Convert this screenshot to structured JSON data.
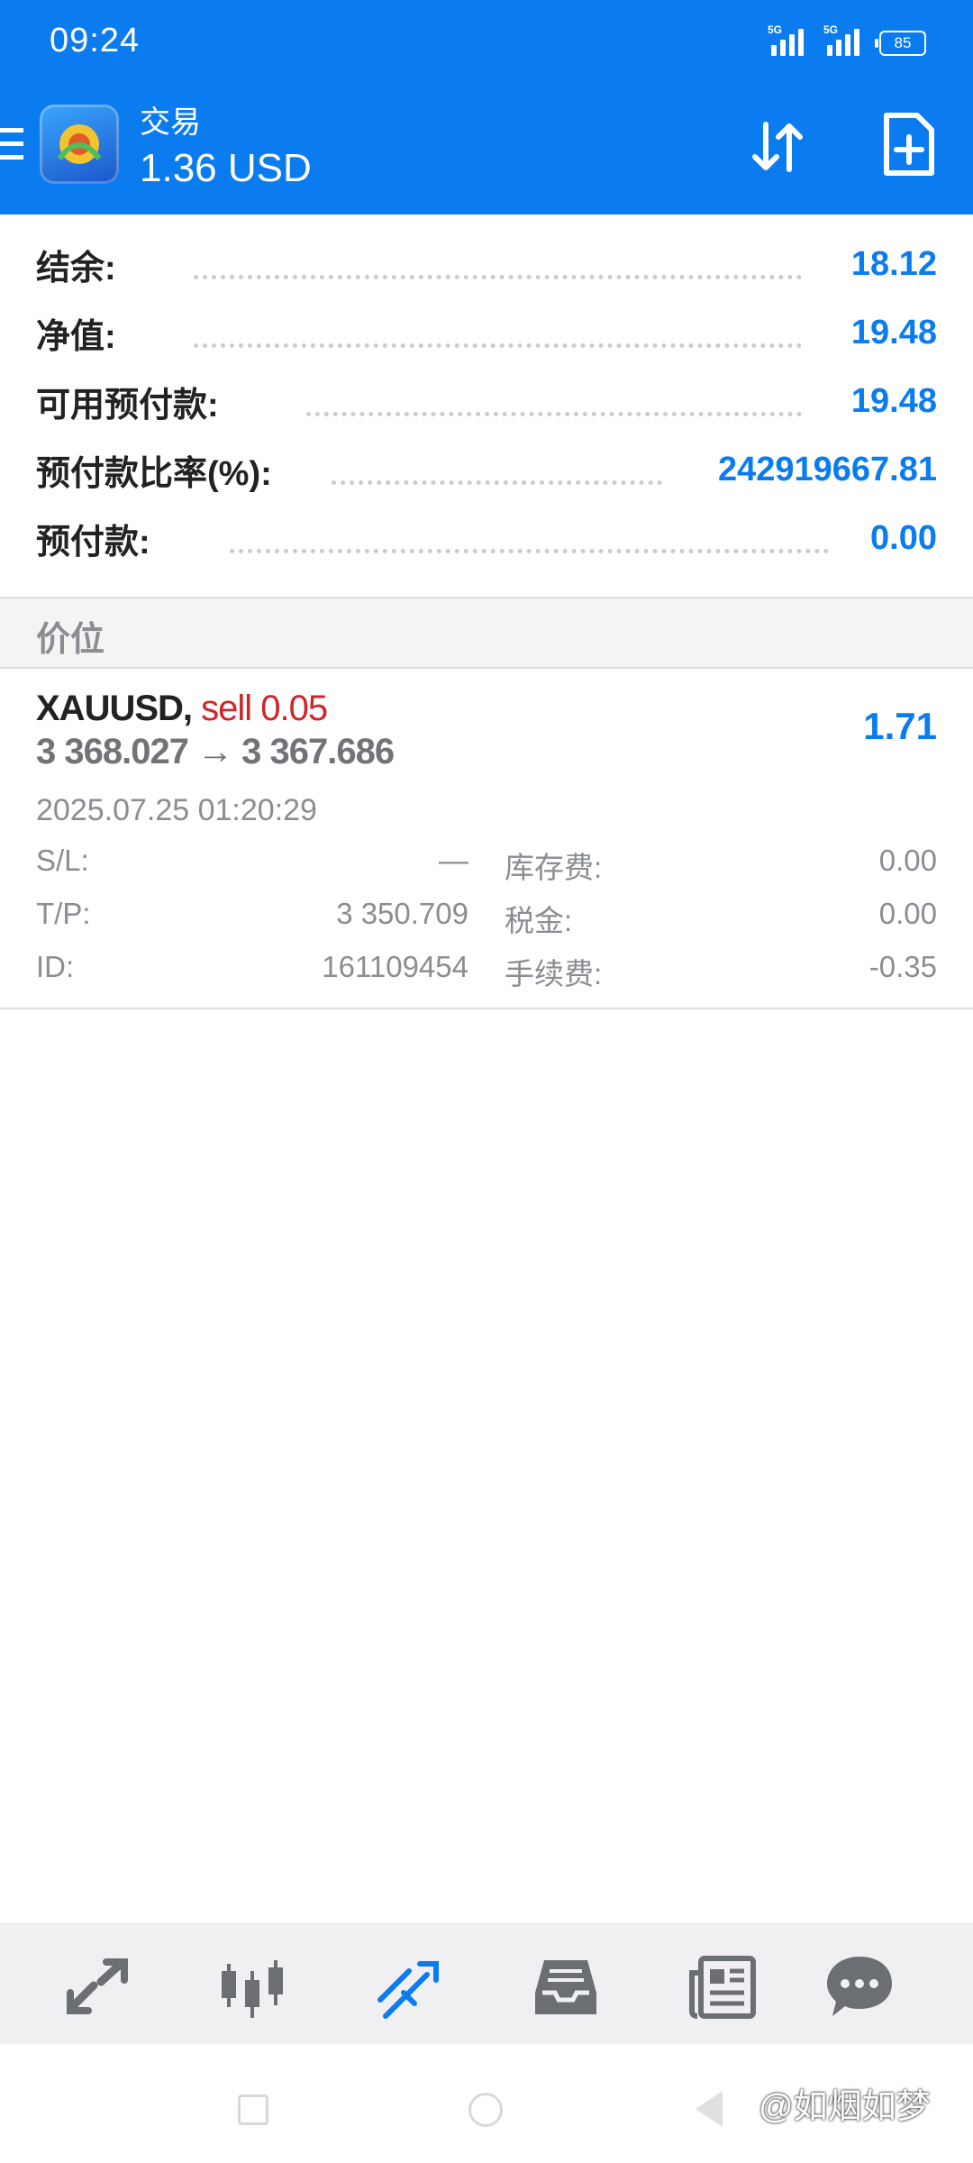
{
  "status_bar": {
    "time": "09:24",
    "signal_1": "5G",
    "signal_2": "5G",
    "battery": "85"
  },
  "header": {
    "title": "交易",
    "balance": "1.36 USD"
  },
  "summary": [
    {
      "label": "结余:",
      "value": "18.12"
    },
    {
      "label": "净值:",
      "value": "19.48"
    },
    {
      "label": "可用预付款:",
      "value": "19.48"
    },
    {
      "label": "预付款比率(%):",
      "value": "242919667.81"
    },
    {
      "label": "预付款:",
      "value": "0.00"
    }
  ],
  "section_title": "价位",
  "position": {
    "symbol": "XAUUSD,",
    "type": "sell 0.05",
    "prices": "3 368.027 → 3 367.686",
    "profit": "1.71",
    "time": "2025.07.25 01:20:29",
    "details": [
      {
        "l1": "S/L:",
        "v1": "—",
        "l2": "库存费:",
        "v2": "0.00"
      },
      {
        "l1": "T/P:",
        "v1": "3 350.709",
        "l2": "税金:",
        "v2": "0.00"
      },
      {
        "l1": "ID:",
        "v1": "161109454",
        "l2": "手续费:",
        "v2": "-0.35"
      }
    ]
  },
  "tabbar": {
    "items": [
      {
        "icon": "quotes-icon",
        "active": false
      },
      {
        "icon": "chart-icon",
        "active": false
      },
      {
        "icon": "trade-icon",
        "active": true
      },
      {
        "icon": "history-icon",
        "active": false
      },
      {
        "icon": "news-icon",
        "active": false
      },
      {
        "icon": "messages-icon",
        "active": false
      }
    ]
  },
  "watermark": "@如烟如梦",
  "colors": {
    "primary": "#0a7cf0",
    "sell": "#d0242b",
    "muted": "#8a8d92"
  }
}
